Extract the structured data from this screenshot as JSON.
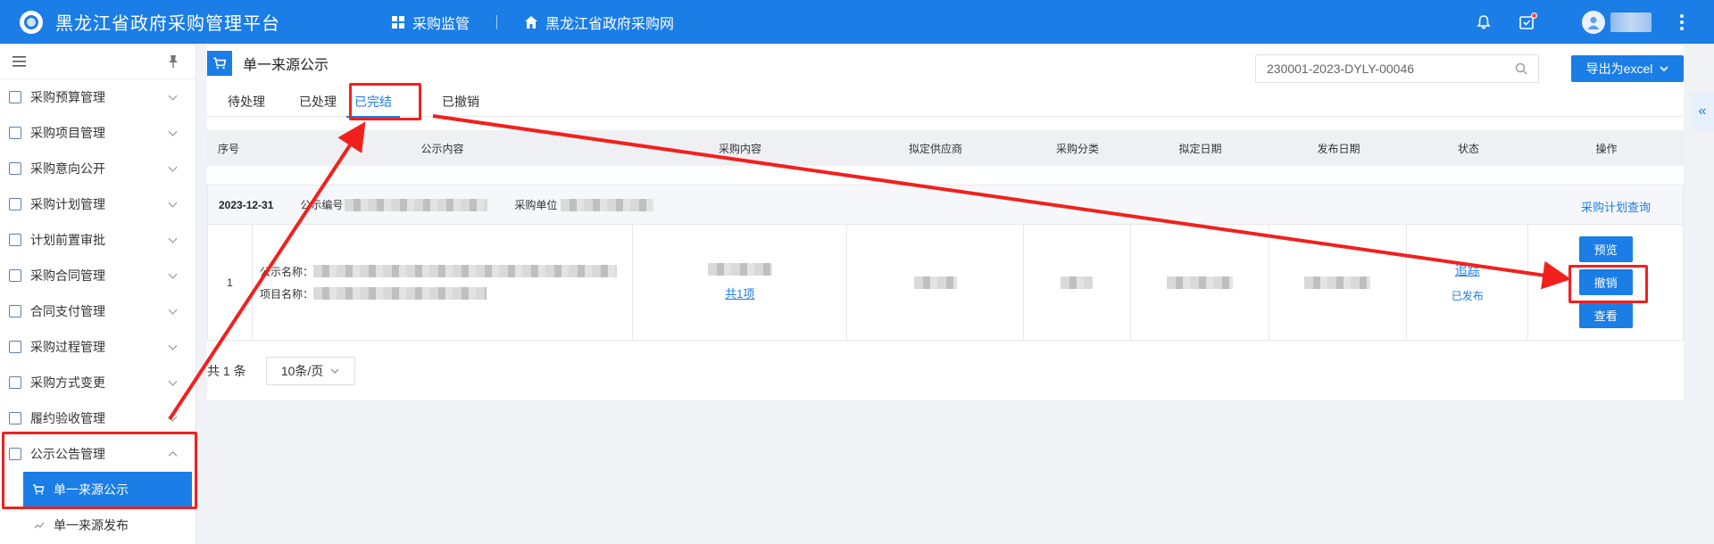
{
  "app": {
    "title": "黑龙江省政府采购管理平台"
  },
  "topnav": {
    "item1": "采购监管",
    "item2": "黑龙江省政府采购网"
  },
  "sidebar": {
    "items": [
      {
        "label": "采购预算管理"
      },
      {
        "label": "采购项目管理"
      },
      {
        "label": "采购意向公开"
      },
      {
        "label": "采购计划管理"
      },
      {
        "label": "计划前置审批"
      },
      {
        "label": "采购合同管理"
      },
      {
        "label": "合同支付管理"
      },
      {
        "label": "采购过程管理"
      },
      {
        "label": "采购方式变更"
      },
      {
        "label": "履约验收管理"
      },
      {
        "label": "公示公告管理"
      }
    ],
    "sub_active": "单一来源公示",
    "sub_next": "单一来源发布"
  },
  "page": {
    "title": "单一来源公示"
  },
  "search": {
    "value": "230001-2023-DYLY-00046"
  },
  "export": {
    "label": "导出为excel"
  },
  "tabs": [
    "待处理",
    "已处理",
    "已完结",
    "已撤销"
  ],
  "table": {
    "headers": [
      "序号",
      "公示内容",
      "采购内容",
      "拟定供应商",
      "采购分类",
      "拟定日期",
      "发布日期",
      "状态",
      "操作"
    ]
  },
  "group": {
    "date": "2023-12-31",
    "notice_no_label": "公示编号",
    "unit_label": "采购单位",
    "plan_link": "采购计划查询"
  },
  "row": {
    "index": "1",
    "notice_name_label": "公示名称：",
    "project_name_label": "项目名称：",
    "items_link": "共1项",
    "status_trace": "追踪",
    "status": "已发布",
    "ops": [
      "预览",
      "撤销",
      "查看"
    ]
  },
  "footer": {
    "total": "共 1 条",
    "page_size": "10条/页"
  },
  "colors": {
    "primary": "#1b7de6",
    "annotation": "#f2201d"
  }
}
